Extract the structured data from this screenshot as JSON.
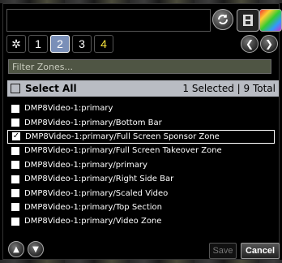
{
  "tabs": [
    "1",
    "2",
    "3",
    "4"
  ],
  "active_tab": "2",
  "filter_placeholder": "Filter Zones...",
  "header": {
    "select_all_label": "Select All",
    "selection_count": "1 Selected | 9 Total"
  },
  "zones": [
    {
      "label": "DMP8Video-1:primary",
      "checked": false
    },
    {
      "label": "DMP8Video-1:primary/Bottom Bar",
      "checked": false
    },
    {
      "label": "DMP8Video-1:primary/Full Screen Sponsor Zone",
      "checked": true
    },
    {
      "label": "DMP8Video-1:primary/Full Screen Takeover Zone",
      "checked": false
    },
    {
      "label": "DMP8Video-1:primary/primary",
      "checked": false
    },
    {
      "label": "DMP8Video-1:primary/Right Side Bar",
      "checked": false
    },
    {
      "label": "DMP8Video-1:primary/Scaled Video",
      "checked": false
    },
    {
      "label": "DMP8Video-1:primary/Top Section",
      "checked": false
    },
    {
      "label": "DMP8Video-1:primary/Video Zone",
      "checked": false
    }
  ],
  "buttons": {
    "save": "Save",
    "cancel": "Cancel"
  },
  "icons": {
    "star": "star-icon",
    "sync": "sync-icon",
    "film": "film-icon",
    "color": "color-palette-icon",
    "prev": "chevron-left-icon",
    "next": "chevron-right-icon",
    "up": "chevron-up-icon",
    "down": "chevron-down-icon"
  },
  "colors": {
    "header_bg": "#b9bcc3",
    "active_tab": "#7a8fb8",
    "filter_bg": "#4f5544"
  }
}
